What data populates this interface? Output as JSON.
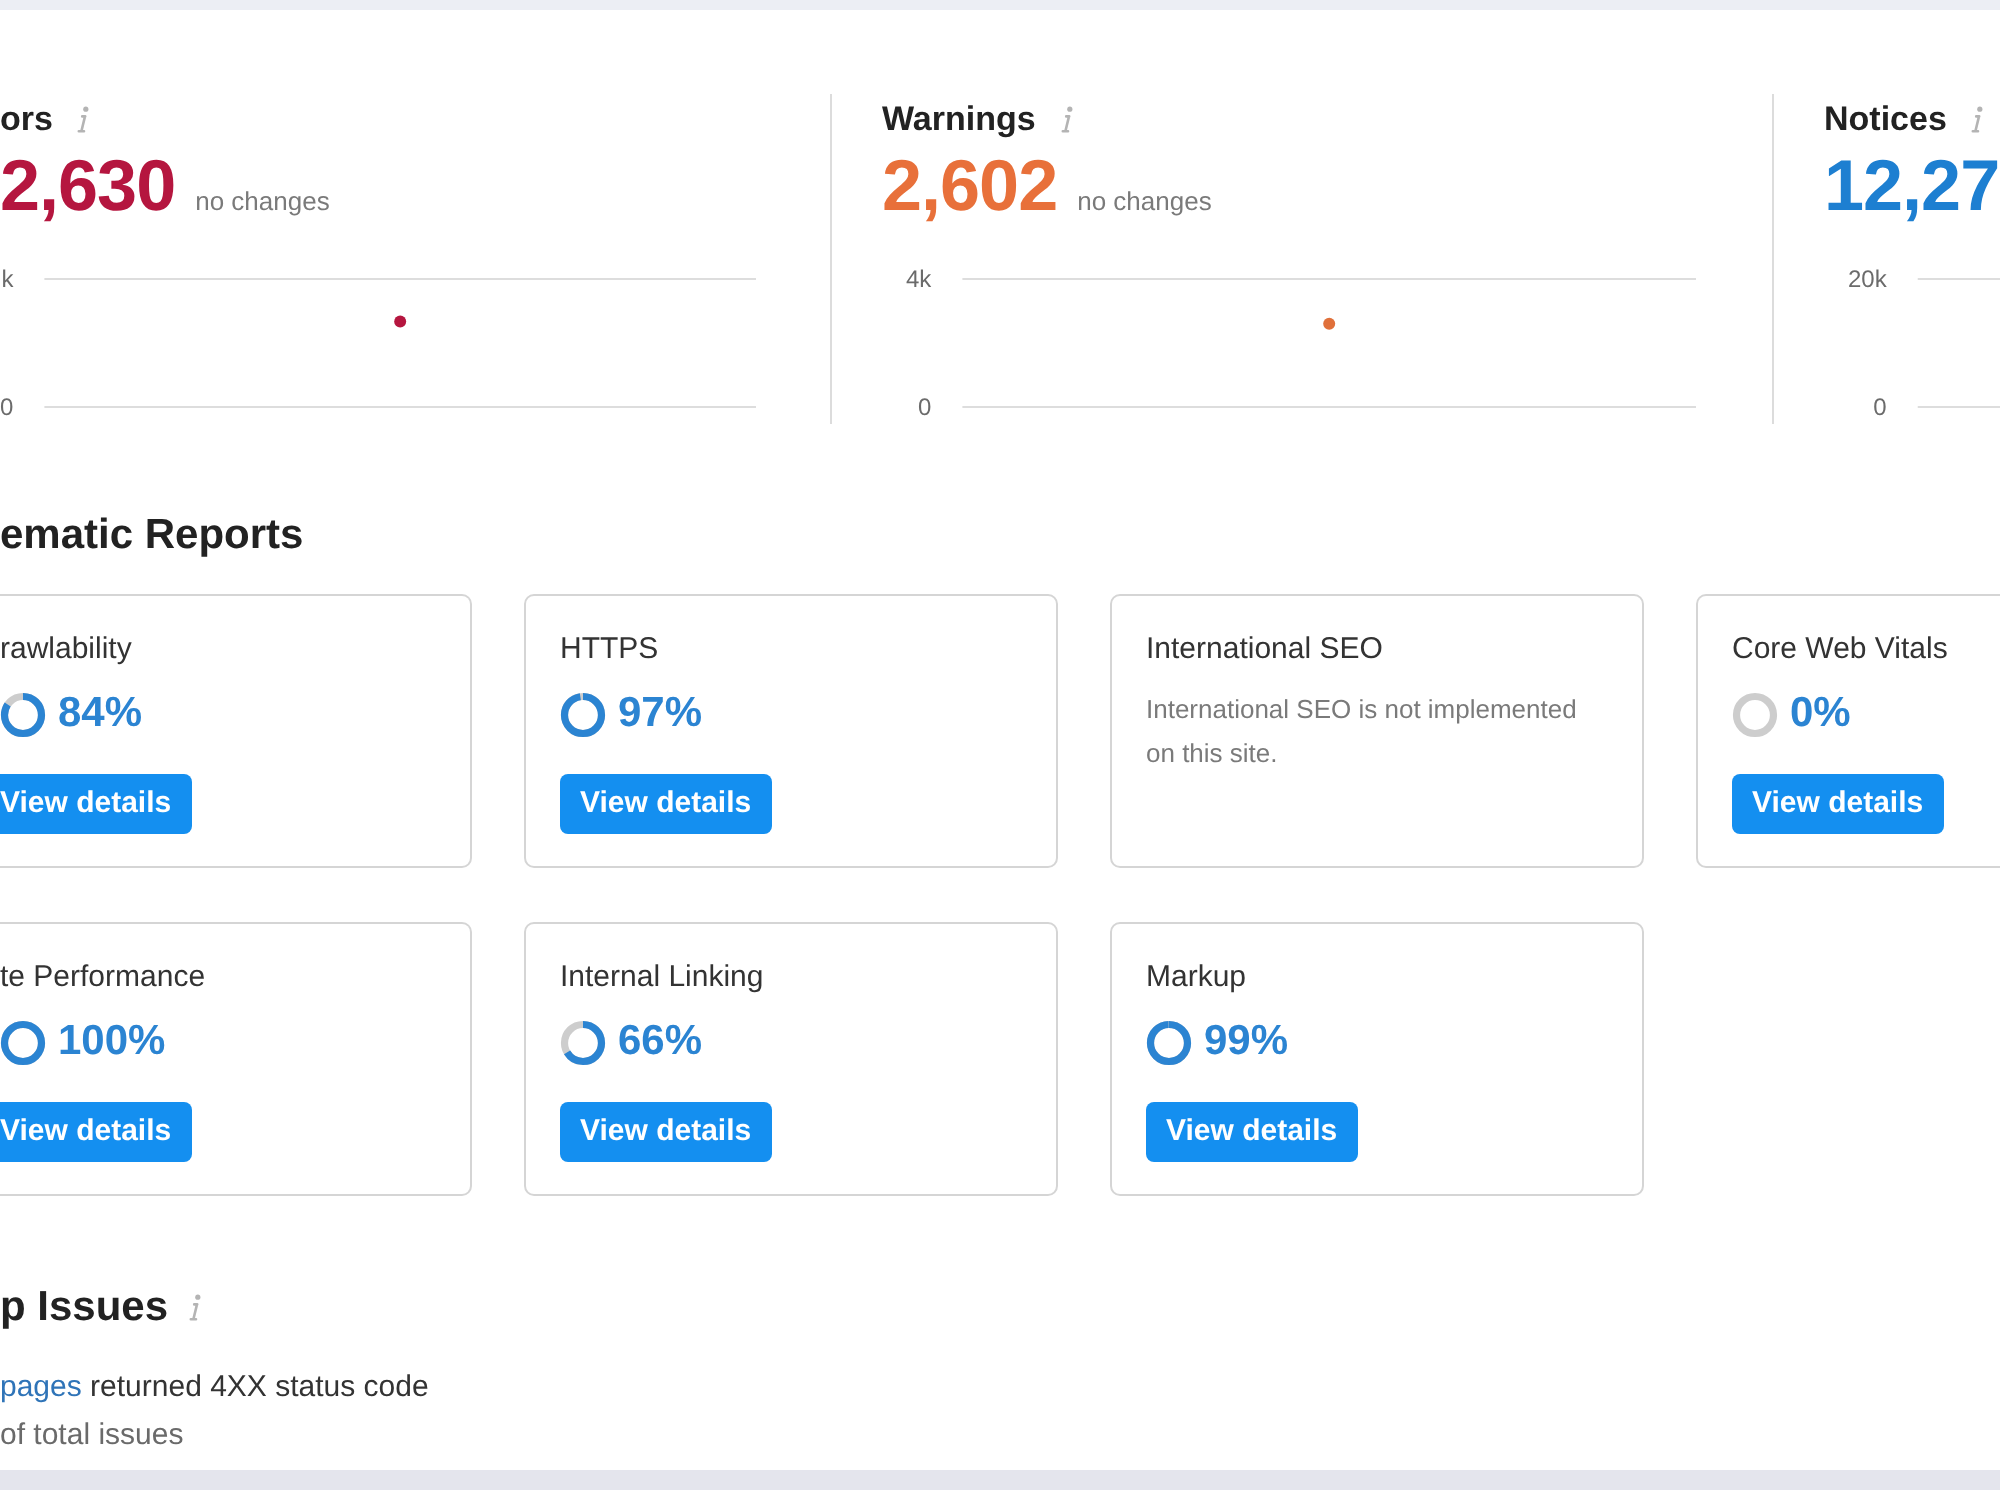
{
  "summary": [
    {
      "title": "ors",
      "value": "2,630",
      "change": "no changes",
      "color": "#b5163f",
      "chart": {
        "axis_labels": [
          "k",
          "0"
        ],
        "dot": true
      }
    },
    {
      "title": "Warnings",
      "value": "2,602",
      "change": "no changes",
      "color": "#e8703a",
      "chart_data": {
        "type": "scatter",
        "categories": [
          null
        ],
        "ylim": [
          0,
          4000
        ],
        "yticks": [
          0,
          {
            "value": 4000,
            "label": "4k"
          }
        ],
        "series": [
          {
            "color": "#e0703a",
            "values": [
              2600
            ]
          }
        ]
      }
    },
    {
      "title": "Notices",
      "value": "12,27",
      "color": "#1d7fd1",
      "chart": {
        "axis_labels": [
          "20k",
          "0"
        ]
      }
    }
  ],
  "thematic_reports": {
    "title": "ematic Reports",
    "cards": [
      {
        "title": "rawlability",
        "kind": "score",
        "percent": "84%",
        "level": 0.84,
        "button": "View details"
      },
      {
        "title": "HTTPS",
        "kind": "score",
        "percent": "97%",
        "level": 0.97,
        "button": "View details"
      },
      {
        "title": "International SEO",
        "kind": "message",
        "message": "International SEO is not implemented on this site."
      },
      {
        "title": "Core Web Vitals",
        "kind": "score",
        "percent": "0%",
        "level": 0,
        "button": "View details"
      },
      {
        "title": "te Performance",
        "kind": "score",
        "percent": "100%",
        "level": 1,
        "button": "View details"
      },
      {
        "title": "Internal Linking",
        "kind": "score",
        "percent": "66%",
        "level": 0.66,
        "button": "View details"
      },
      {
        "title": "Markup",
        "kind": "score",
        "percent": "99%",
        "level": 0.99,
        "button": "View details"
      }
    ]
  },
  "top_issues": {
    "title": "p Issues",
    "issues": [
      {
        "link": "pages",
        "text": "returned 4XX status code",
        "share": "of total issues"
      }
    ]
  }
}
